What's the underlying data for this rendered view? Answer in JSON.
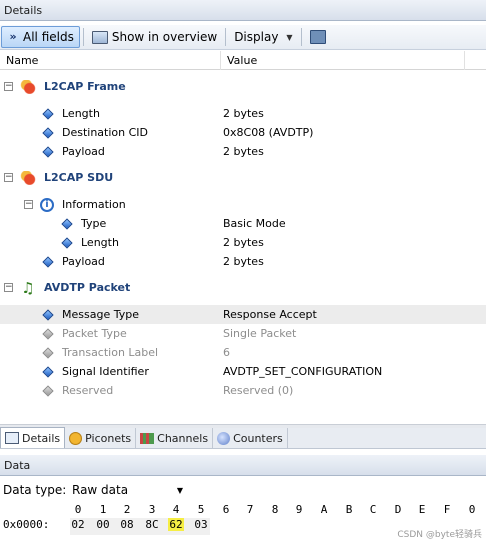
{
  "details_panel": {
    "title": "Details"
  },
  "toolbar": {
    "all_fields": "All fields",
    "show_overview": "Show in overview",
    "display": "Display"
  },
  "columns": {
    "name": "Name",
    "value": "Value"
  },
  "tree": {
    "l2cap_frame": {
      "label": "L2CAP Frame",
      "rows": [
        {
          "name": "Length",
          "value": "2 bytes"
        },
        {
          "name": "Destination CID",
          "value": "0x8C08 (AVDTP)"
        },
        {
          "name": "Payload",
          "value": "2 bytes"
        }
      ]
    },
    "l2cap_sdu": {
      "label": "L2CAP SDU",
      "information": {
        "label": "Information",
        "rows": [
          {
            "name": "Type",
            "value": "Basic Mode"
          },
          {
            "name": "Length",
            "value": "2 bytes"
          }
        ]
      },
      "payload": {
        "name": "Payload",
        "value": "2 bytes"
      }
    },
    "avdtp_packet": {
      "label": "AVDTP Packet",
      "rows": [
        {
          "name": "Message Type",
          "value": "Response Accept",
          "state": "selected"
        },
        {
          "name": "Packet Type",
          "value": "Single Packet",
          "state": "gray"
        },
        {
          "name": "Transaction Label",
          "value": "6",
          "state": "gray"
        },
        {
          "name": "Signal Identifier",
          "value": "AVDTP_SET_CONFIGURATION",
          "state": "normal"
        },
        {
          "name": "Reserved",
          "value": "Reserved (0)",
          "state": "gray"
        }
      ]
    }
  },
  "tabs": [
    {
      "label": "Details",
      "active": true
    },
    {
      "label": "Piconets",
      "active": false
    },
    {
      "label": "Channels",
      "active": false
    },
    {
      "label": "Counters",
      "active": false
    }
  ],
  "data_panel": {
    "title": "Data",
    "data_type_label": "Data type:",
    "data_type_value": "Raw data"
  },
  "hex": {
    "header": [
      "0",
      "1",
      "2",
      "3",
      "4",
      "5",
      "6",
      "7",
      "8",
      "9",
      "A",
      "B",
      "C",
      "D",
      "E",
      "F",
      "0"
    ],
    "address": "0x0000:",
    "bytes": [
      "02",
      "00",
      "08",
      "8C",
      "62",
      "03"
    ],
    "highlight_index": 4
  },
  "watermark": "CSDN @byte轻骑兵",
  "colors": {
    "highlight": "#f6ee45",
    "group_text": "#20437a",
    "selected_row": "#ececec"
  }
}
